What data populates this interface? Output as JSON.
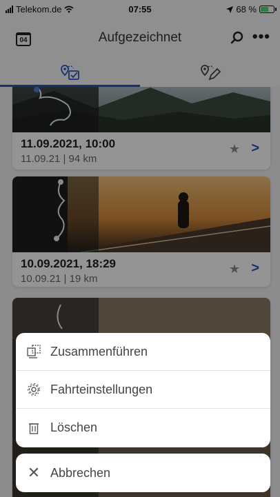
{
  "status_bar": {
    "carrier": "Telekom.de",
    "time": "07:55",
    "battery_text": "68 %",
    "battery_level": 0.68
  },
  "nav": {
    "date_badge": "04",
    "title": "Aufgezeichnet"
  },
  "tabs": [
    {
      "name": "recorded-routes-tab",
      "selected": true
    },
    {
      "name": "planned-routes-tab",
      "selected": false
    }
  ],
  "rides": [
    {
      "title": "11.09.2021, 10:00",
      "subtitle": "11.09.21 | 94 km"
    },
    {
      "title": "10.09.2021, 18:29",
      "subtitle": "10.09.21 | 19 km"
    }
  ],
  "action_sheet": {
    "items": [
      {
        "label": "Zusammenführen",
        "icon": "merge-icon"
      },
      {
        "label": "Fahrteinstellungen",
        "icon": "gear-icon"
      },
      {
        "label": "Löschen",
        "icon": "trash-icon"
      }
    ],
    "cancel": {
      "label": "Abbrechen",
      "icon": "close-icon"
    }
  },
  "colors": {
    "accent": "#1f57c3",
    "overlay": "rgba(0,0,0,0.42)",
    "battery": "#4cd964"
  }
}
